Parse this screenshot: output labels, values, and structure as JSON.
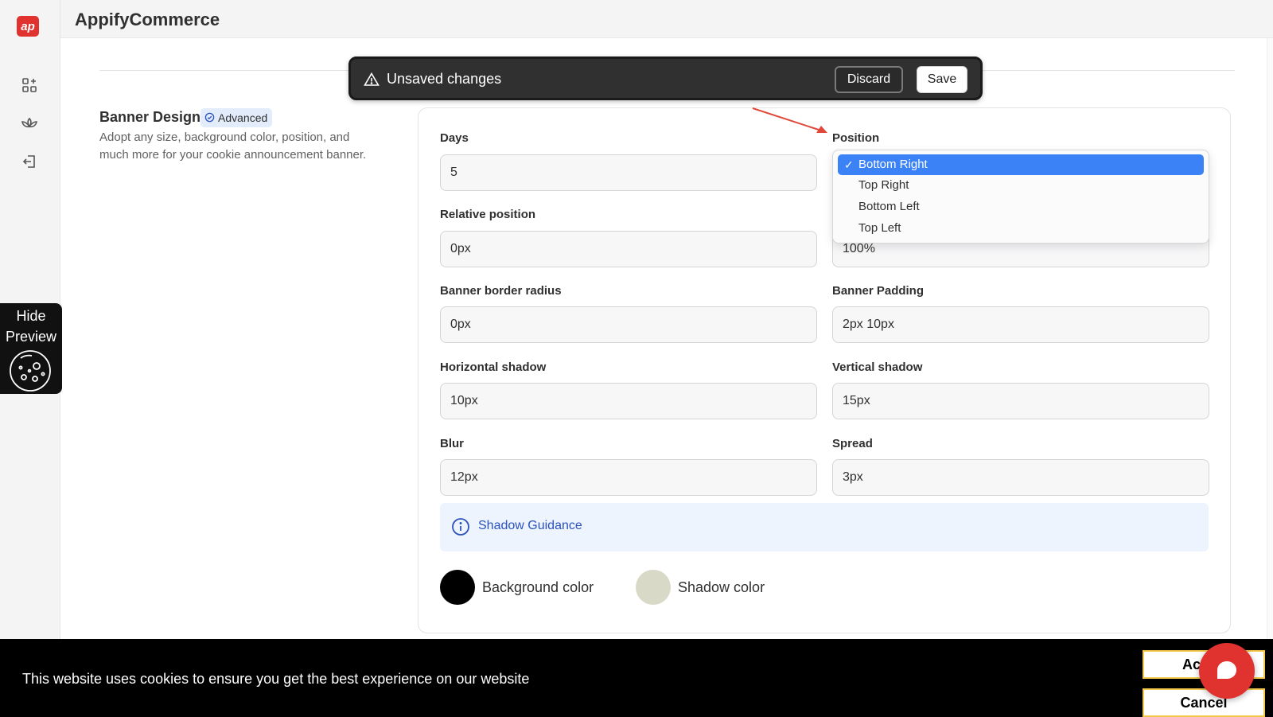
{
  "app": {
    "logo_text": "ap",
    "title": "AppifyCommerce"
  },
  "rail": {
    "icons": [
      "apps-icon",
      "lotus-icon",
      "logout-icon"
    ]
  },
  "unsaved_bar": {
    "text": "Unsaved changes",
    "discard_label": "Discard",
    "save_label": "Save"
  },
  "section": {
    "title": "Banner Design",
    "badge": "Advanced",
    "description": "Adopt any size, background color, position, and much more for your cookie announcement banner."
  },
  "form": {
    "days": {
      "label": "Days",
      "value": "5"
    },
    "position": {
      "label": "Position",
      "selected": "Bottom Right",
      "options": [
        "Bottom Right",
        "Top Right",
        "Bottom Left",
        "Top Left"
      ]
    },
    "relative_position": {
      "label": "Relative position",
      "value": "0px"
    },
    "width": {
      "value": "100%"
    },
    "border_radius": {
      "label": "Banner border radius",
      "value": "0px"
    },
    "padding": {
      "label": "Banner Padding",
      "value": "2px 10px"
    },
    "h_shadow": {
      "label": "Horizontal shadow",
      "value": "10px"
    },
    "v_shadow": {
      "label": "Vertical shadow",
      "value": "15px"
    },
    "blur": {
      "label": "Blur",
      "value": "12px"
    },
    "spread": {
      "label": "Spread",
      "value": "3px"
    },
    "guidance": "Shadow Guidance",
    "bg_color": {
      "label": "Background color",
      "color": "#000000"
    },
    "shadow_color": {
      "label": "Shadow color",
      "color": "#d9d9c8"
    }
  },
  "preview": {
    "line1": "Hide",
    "line2": "Preview"
  },
  "cookie_banner": {
    "text": "This website uses cookies to ensure you get the best experience on our website",
    "accept_label": "Accept",
    "cancel_label": "Cancel"
  },
  "colors": {
    "brand": "#e0322e",
    "selected_option": "#3b82f6",
    "guidance_text": "#2a52be"
  }
}
